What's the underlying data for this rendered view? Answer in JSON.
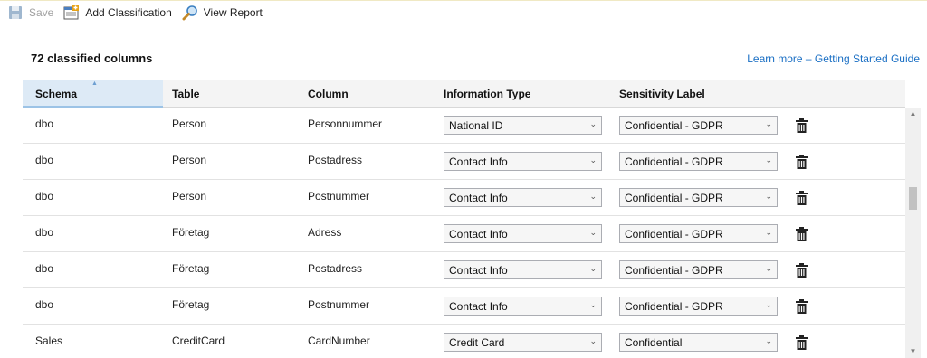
{
  "toolbar": {
    "save_label": "Save",
    "add_label": "Add Classification",
    "view_label": "View Report"
  },
  "summary": {
    "title": "72 classified columns",
    "link": "Learn more – Getting Started Guide"
  },
  "columns": {
    "schema": "Schema",
    "table": "Table",
    "column": "Column",
    "info_type": "Information Type",
    "sensitivity": "Sensitivity Label"
  },
  "rows": [
    {
      "schema": "dbo",
      "table": "Person",
      "column": "Personnummer",
      "info_type": "National ID",
      "label": "Confidential - GDPR"
    },
    {
      "schema": "dbo",
      "table": "Person",
      "column": "Postadress",
      "info_type": "Contact Info",
      "label": "Confidential - GDPR"
    },
    {
      "schema": "dbo",
      "table": "Person",
      "column": "Postnummer",
      "info_type": "Contact Info",
      "label": "Confidential - GDPR"
    },
    {
      "schema": "dbo",
      "table": "Företag",
      "column": "Adress",
      "info_type": "Contact Info",
      "label": "Confidential - GDPR"
    },
    {
      "schema": "dbo",
      "table": "Företag",
      "column": "Postadress",
      "info_type": "Contact Info",
      "label": "Confidential - GDPR"
    },
    {
      "schema": "dbo",
      "table": "Företag",
      "column": "Postnummer",
      "info_type": "Contact Info",
      "label": "Confidential - GDPR"
    },
    {
      "schema": "Sales",
      "table": "CreditCard",
      "column": "CardNumber",
      "info_type": "Credit Card",
      "label": "Confidential"
    }
  ],
  "icons": {
    "save": "save-icon",
    "add": "add-classification-icon",
    "view": "magnifier-icon",
    "delete": "trash-icon",
    "dropdown": "chevron-down-icon"
  },
  "colors": {
    "link": "#1a6fc4",
    "sorted_header": "#ddeaf6"
  }
}
